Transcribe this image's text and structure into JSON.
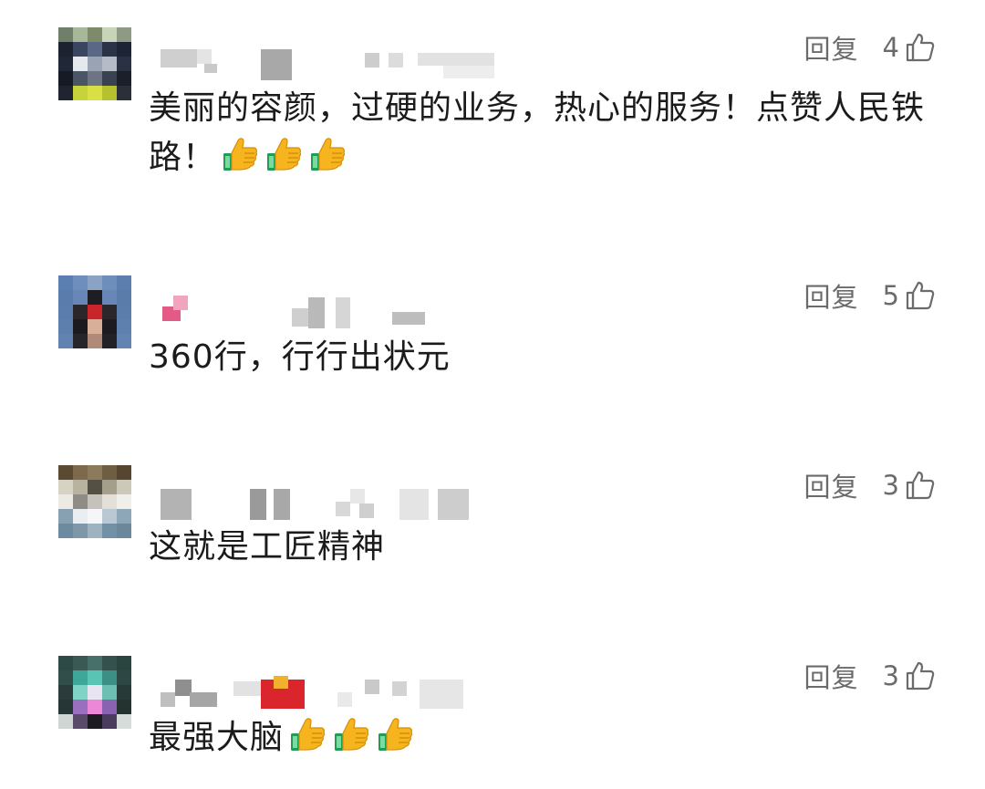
{
  "comments": [
    {
      "reply_label": "回复",
      "like_count": "4",
      "text": "美丽的容颜，过硬的业务，热心的服务！点赞人民铁路！",
      "emoji": [
        "thumbs-up-icon",
        "thumbs-up-icon",
        "thumbs-up-icon"
      ]
    },
    {
      "reply_label": "回复",
      "like_count": "5",
      "text": "360行，行行出状元",
      "emoji": []
    },
    {
      "reply_label": "回复",
      "like_count": "3",
      "text": "这就是工匠精神",
      "emoji": []
    },
    {
      "reply_label": "回复",
      "like_count": "3",
      "text": "最强大脑",
      "emoji": [
        "thumbs-up-icon",
        "thumbs-up-icon",
        "thumbs-up-icon"
      ]
    }
  ],
  "colors": {
    "meta_text": "#6b6b6b",
    "body_text": "#1b1b1b",
    "emoji_yellow": "#f6b51e",
    "emoji_cuff": "#1f9d55"
  }
}
